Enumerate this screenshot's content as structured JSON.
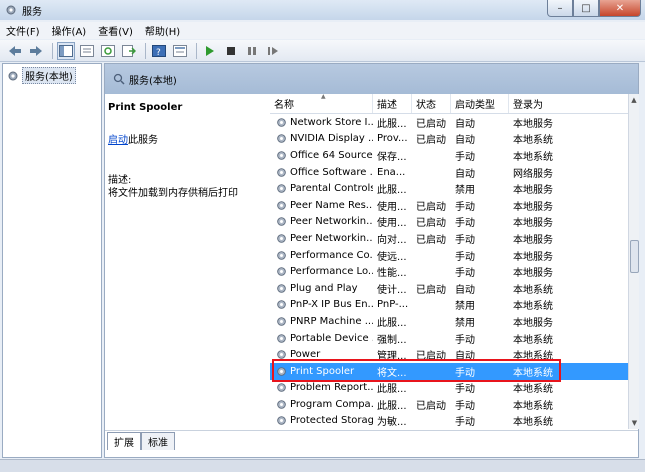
{
  "window": {
    "title": "服务"
  },
  "menu": [
    "文件(F)",
    "操作(A)",
    "查看(V)",
    "帮助(H)"
  ],
  "left_pane": {
    "item_label": "服务(本地)"
  },
  "header": {
    "title": "服务(本地)"
  },
  "description": {
    "service_name": "Print Spooler",
    "action_link": "启动",
    "action_suffix": "此服务",
    "desc_label": "描述:",
    "desc_text": "将文件加载到内存供稍后打印"
  },
  "columns": {
    "name": "名称",
    "desc": "描述",
    "status": "状态",
    "type": "启动类型",
    "logon": "登录为"
  },
  "rows": [
    {
      "name": "Network Store I...",
      "desc": "此服...",
      "status": "已启动",
      "type": "自动",
      "logon": "本地服务"
    },
    {
      "name": "NVIDIA Display ...",
      "desc": "Prov...",
      "status": "已启动",
      "type": "自动",
      "logon": "本地系统"
    },
    {
      "name": "Office 64 Source...",
      "desc": "保存...",
      "status": "",
      "type": "手动",
      "logon": "本地系统"
    },
    {
      "name": "Office Software ...",
      "desc": "Ena...",
      "status": "",
      "type": "自动",
      "logon": "网络服务"
    },
    {
      "name": "Parental Controls",
      "desc": "此服...",
      "status": "",
      "type": "禁用",
      "logon": "本地服务"
    },
    {
      "name": "Peer Name Res...",
      "desc": "使用...",
      "status": "已启动",
      "type": "手动",
      "logon": "本地服务"
    },
    {
      "name": "Peer Networkin...",
      "desc": "使用...",
      "status": "已启动",
      "type": "手动",
      "logon": "本地服务"
    },
    {
      "name": "Peer Networkin...",
      "desc": "向对...",
      "status": "已启动",
      "type": "手动",
      "logon": "本地服务"
    },
    {
      "name": "Performance Co...",
      "desc": "使远...",
      "status": "",
      "type": "手动",
      "logon": "本地服务"
    },
    {
      "name": "Performance Lo...",
      "desc": "性能...",
      "status": "",
      "type": "手动",
      "logon": "本地服务"
    },
    {
      "name": "Plug and Play",
      "desc": "使计...",
      "status": "已启动",
      "type": "自动",
      "logon": "本地系统"
    },
    {
      "name": "PnP-X IP Bus En...",
      "desc": "PnP-...",
      "status": "",
      "type": "禁用",
      "logon": "本地系统"
    },
    {
      "name": "PNRP Machine ...",
      "desc": "此服...",
      "status": "",
      "type": "禁用",
      "logon": "本地服务"
    },
    {
      "name": "Portable Device ...",
      "desc": "强制...",
      "status": "",
      "type": "手动",
      "logon": "本地系统"
    },
    {
      "name": "Power",
      "desc": "管理...",
      "status": "已启动",
      "type": "自动",
      "logon": "本地系统"
    },
    {
      "name": "Print Spooler",
      "desc": "将文...",
      "status": "",
      "type": "手动",
      "logon": "本地系统"
    },
    {
      "name": "Problem Report...",
      "desc": "此服...",
      "status": "",
      "type": "手动",
      "logon": "本地系统"
    },
    {
      "name": "Program Compa...",
      "desc": "此服...",
      "status": "已启动",
      "type": "手动",
      "logon": "本地系统"
    },
    {
      "name": "Protected Storage",
      "desc": "为敏...",
      "status": "",
      "type": "手动",
      "logon": "本地系统"
    }
  ],
  "selected_index": 15,
  "tabs": [
    "扩展",
    "标准"
  ],
  "colors": {
    "selection": "#3399ff",
    "highlight_box": "#e8141c",
    "link": "#0044cc"
  }
}
